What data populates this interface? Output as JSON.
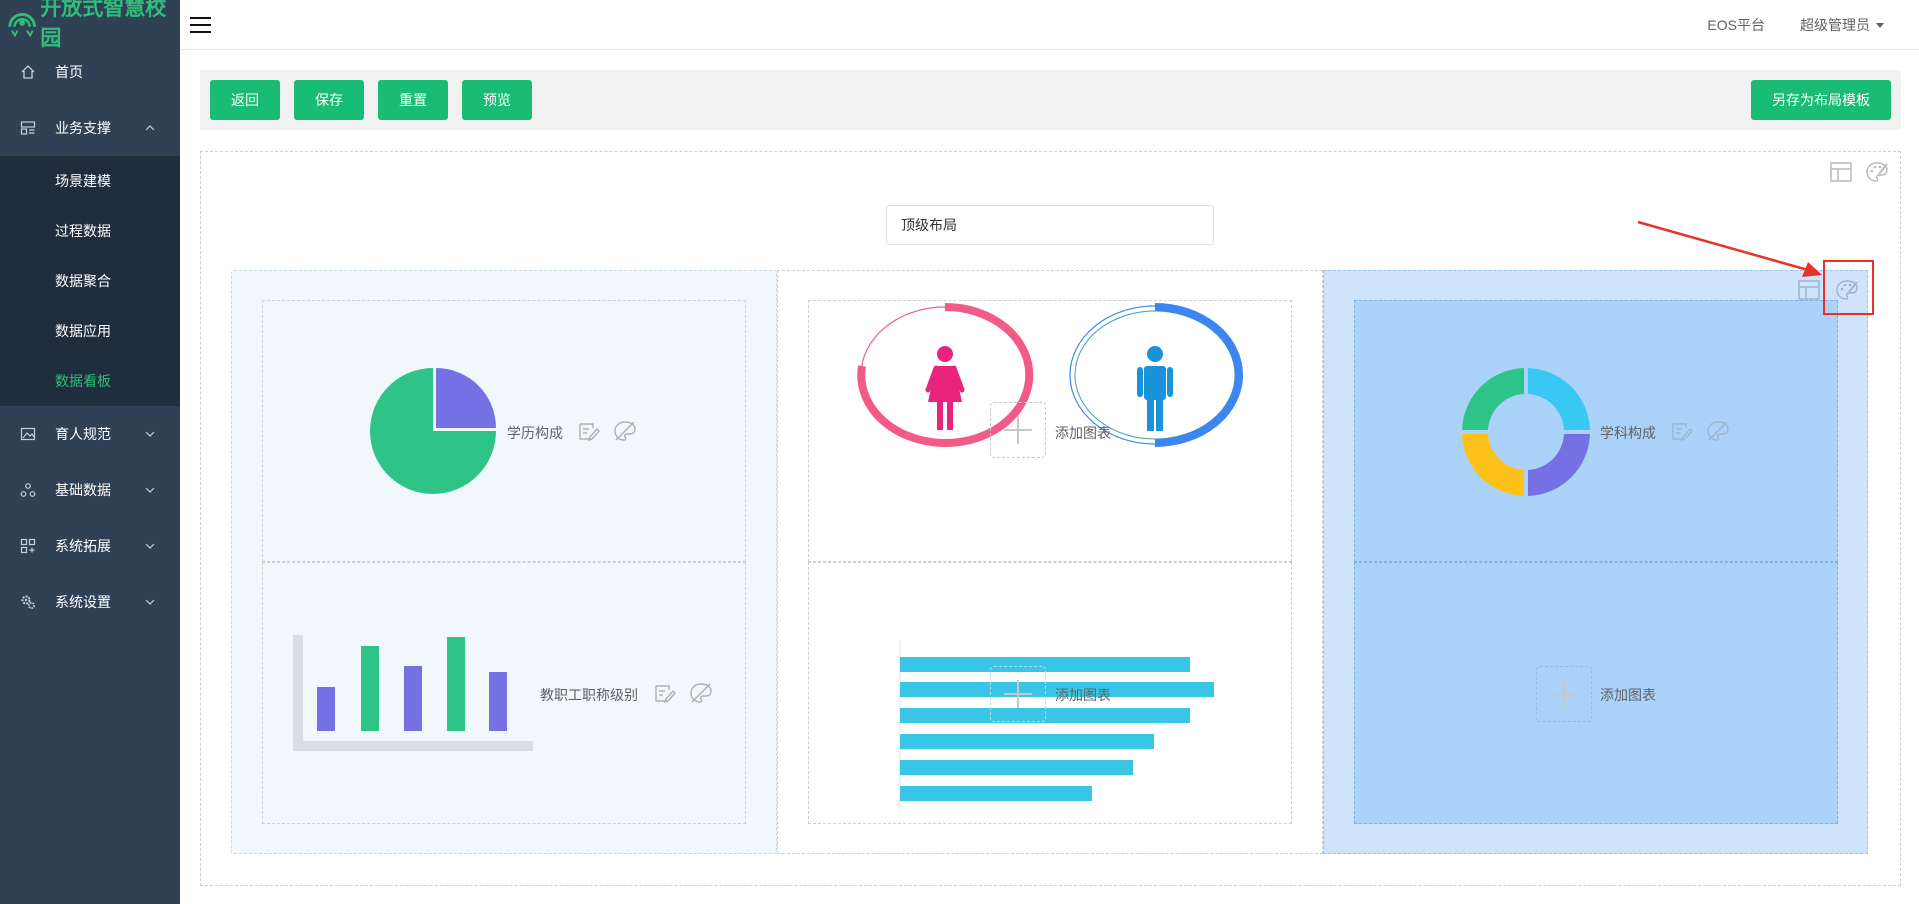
{
  "app": {
    "logo_text": "开放式智慧校园"
  },
  "sidebar": {
    "items": [
      {
        "label": "首页",
        "icon": "home-icon"
      },
      {
        "label": "业务支撑",
        "icon": "layout-icon",
        "expanded": true,
        "children": [
          "场景建模",
          "过程数据",
          "数据聚合",
          "数据应用",
          "数据看板"
        ],
        "active_child": "数据看板"
      },
      {
        "label": "育人规范",
        "icon": "picture-icon"
      },
      {
        "label": "基础数据",
        "icon": "cluster-icon"
      },
      {
        "label": "系统拓展",
        "icon": "apps-icon"
      },
      {
        "label": "系统设置",
        "icon": "gears-icon"
      }
    ]
  },
  "header": {
    "platform": "EOS平台",
    "user": "超级管理员"
  },
  "toolbar": {
    "back": "返回",
    "save": "保存",
    "reset": "重置",
    "preview": "预览",
    "save_template": "另存为布局模板"
  },
  "canvas": {
    "layout_name": "顶级布局",
    "cells": {
      "c1a": {
        "label": "学历构成"
      },
      "c1b": {
        "label": "教职工职称级别"
      },
      "c2a": {
        "label": "添加图表"
      },
      "c2b": {
        "label": "添加图表"
      },
      "c3a": {
        "label": "学科构成"
      },
      "c3b": {
        "label": "添加图表"
      }
    }
  },
  "colors": {
    "accent": "#18bc74",
    "sidebar_bg": "#304156",
    "submenu_bg": "#1f2d3d",
    "pie_green": "#2ec487",
    "pie_purple": "#7571e4",
    "bar_cyan": "#39c6e6",
    "female_pink": "#f25b85",
    "male_blue": "#3d86f2",
    "donut_cyan": "#39c8f1",
    "donut_yellow": "#fdc21a",
    "annotation_red": "#e8312a"
  }
}
